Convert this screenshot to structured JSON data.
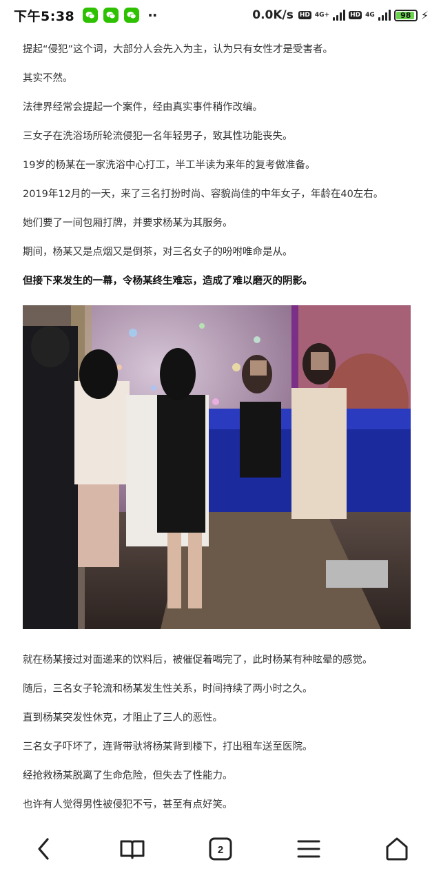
{
  "status_bar": {
    "time": "下午5:38",
    "dots": "··",
    "net_speed": "0.0K/s",
    "hd_label": "HD",
    "net_label_1": "4G+",
    "net_label_2": "4G",
    "battery_level": "98"
  },
  "article": {
    "paragraphs": [
      "提起“侵犯”这个词，大部分人会先入为主，认为只有女性才是受害者。",
      "其实不然。",
      "法律界经常会提起一个案件，经由真实事件稍作改编。",
      "三女子在洗浴场所轮流侵犯一名年轻男子，致其性功能丧失。",
      "19岁的杨某在一家洗浴中心打工，半工半读为来年的复考做准备。",
      "2019年12月的一天，来了三名打扮时尚、容貌尚佳的中年女子，年龄在40左右。",
      "她们要了一间包厢打牌，并要求杨某为其服务。",
      "期间，杨某又是点烟又是倒茶，对三名女子的吩咐唯命是从。",
      "但接下来发生的一幕，令杨某终生难忘，造成了难以磨灭的阴影。"
    ],
    "paragraphs_after": [
      "就在杨某接过对面递来的饮料后，被催促着喝完了，此时杨某有种眩晕的感觉。",
      "随后，三名女子轮流和杨某发生性关系，时间持续了两小时之久。",
      "直到杨某突发性休克，才阻止了三人的恶性。",
      "三名女子吓坏了，连背带驮将杨某背到楼下，打出租车送至医院。",
      "经抢救杨某脱离了生命危险，但失去了性能力。",
      "也许有人觉得男性被侵犯不亏，甚至有点好笑。"
    ]
  },
  "bottom_nav": {
    "tab_count": "2"
  }
}
